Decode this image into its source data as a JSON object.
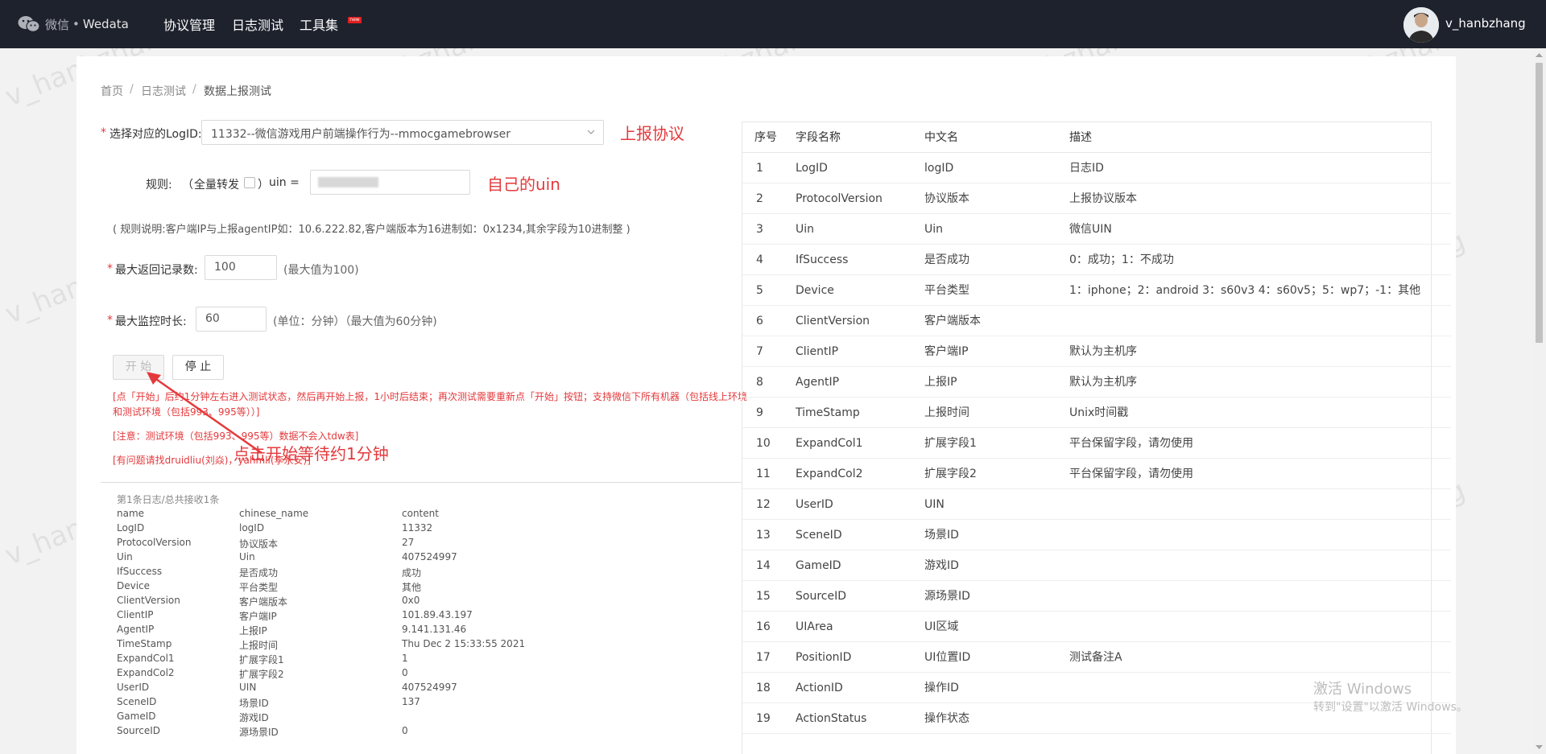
{
  "header": {
    "brand": "微信",
    "brand_sep": "•",
    "brand_name": "Wedata",
    "nav": [
      "协议管理",
      "日志测试",
      "工具集"
    ],
    "new_badge": "new",
    "username": "v_hanbzhang"
  },
  "breadcrumb": [
    "首页",
    "日志测试",
    "数据上报测试"
  ],
  "form": {
    "logid_label": "选择对应的LogID:",
    "logid_value": "11332--微信游戏用户前端操作行为--mmocgamebrowser",
    "logid_annotation": "上报协议",
    "rule_label": "规则:",
    "rule_open": "（",
    "rule_full_forward": "全量转发",
    "rule_close": "）",
    "uin_label": "uin =",
    "uin_annotation": "自己的uin",
    "rule_note": "( 规则说明:客户端IP与上报agentIP如：10.6.222.82,客户端版本为16进制如：0x1234,其余字段为10进制整 )",
    "max_records_label": "最大返回记录数:",
    "max_records_value": "100",
    "max_records_hint": "(最大值为100)",
    "max_time_label": "最大监控时长:",
    "max_time_value": "60",
    "max_time_hint": "(单位：分钟）（最大值为60分钟)",
    "start_button": "开 始",
    "stop_button": "停 止",
    "note_1": "[点「开始」后约1分钟左右进入测试状态，然后再开始上报，1小时后结束；再次测试需要重新点「开始」按钮；支持微信下所有机器（包括线上环境",
    "note_1b": "和测试环境（包括993、995等））]",
    "note_2": "[注意：测试环境（包括993、995等）数据不会入tdw表]",
    "note_3": "[有问题请找druidliu(刘焱)，yahmli(李永安)]",
    "arrow_annotation": "点击开始等待约1分钟"
  },
  "log": {
    "title": "第1条日志/总共接收1条",
    "headers": [
      "name",
      "chinese_name",
      "content"
    ],
    "rows": [
      [
        "LogID",
        "logID",
        "11332"
      ],
      [
        "ProtocolVersion",
        "协议版本",
        "27"
      ],
      [
        "Uin",
        "Uin",
        "407524997"
      ],
      [
        "IfSuccess",
        "是否成功",
        "成功"
      ],
      [
        "Device",
        "平台类型",
        "其他"
      ],
      [
        "ClientVersion",
        "客户端版本",
        "0x0"
      ],
      [
        "ClientIP",
        "客户端IP",
        "101.89.43.197"
      ],
      [
        "AgentIP",
        "上报IP",
        "9.141.131.46"
      ],
      [
        "TimeStamp",
        "上报时间",
        "Thu Dec 2 15:33:55 2021"
      ],
      [
        "ExpandCol1",
        "扩展字段1",
        "1"
      ],
      [
        "ExpandCol2",
        "扩展字段2",
        "0"
      ],
      [
        "UserID",
        "UIN",
        "407524997"
      ],
      [
        "SceneID",
        "场景ID",
        "137"
      ],
      [
        "GameID",
        "游戏ID",
        ""
      ],
      [
        "SourceID",
        "源场景ID",
        "0"
      ]
    ]
  },
  "table": {
    "headers": [
      "序号",
      "字段名称",
      "中文名",
      "描述"
    ],
    "rows": [
      [
        "1",
        "LogID",
        "logID",
        "日志ID"
      ],
      [
        "2",
        "ProtocolVersion",
        "协议版本",
        "上报协议版本"
      ],
      [
        "3",
        "Uin",
        "Uin",
        "微信UIN"
      ],
      [
        "4",
        "IfSuccess",
        "是否成功",
        "0：成功；1：不成功"
      ],
      [
        "5",
        "Device",
        "平台类型",
        "1：iphone；2：android 3：s60v3 4：s60v5；5：wp7；-1：其他"
      ],
      [
        "6",
        "ClientVersion",
        "客户端版本",
        ""
      ],
      [
        "7",
        "ClientIP",
        "客户端IP",
        "默认为主机序"
      ],
      [
        "8",
        "AgentIP",
        "上报IP",
        "默认为主机序"
      ],
      [
        "9",
        "TimeStamp",
        "上报时间",
        "Unix时间戳"
      ],
      [
        "10",
        "ExpandCol1",
        "扩展字段1",
        "平台保留字段，请勿使用"
      ],
      [
        "11",
        "ExpandCol2",
        "扩展字段2",
        "平台保留字段，请勿使用"
      ],
      [
        "12",
        "UserID",
        "UIN",
        ""
      ],
      [
        "13",
        "SceneID",
        "场景ID",
        ""
      ],
      [
        "14",
        "GameID",
        "游戏ID",
        ""
      ],
      [
        "15",
        "SourceID",
        "源场景ID",
        ""
      ],
      [
        "16",
        "UIArea",
        "UI区域",
        ""
      ],
      [
        "17",
        "PositionID",
        "UI位置ID",
        "测试备注A"
      ],
      [
        "18",
        "ActionID",
        "操作ID",
        ""
      ],
      [
        "19",
        "ActionStatus",
        "操作状态",
        ""
      ]
    ]
  },
  "watermark": "v_hanbzhang",
  "activation": {
    "title": "激活 Windows",
    "subtitle": "转到\"设置\"以激活 Windows。"
  },
  "colors": {
    "topbar": "#1e222d",
    "required": "#e4393c",
    "annotation": "#e4393c"
  }
}
